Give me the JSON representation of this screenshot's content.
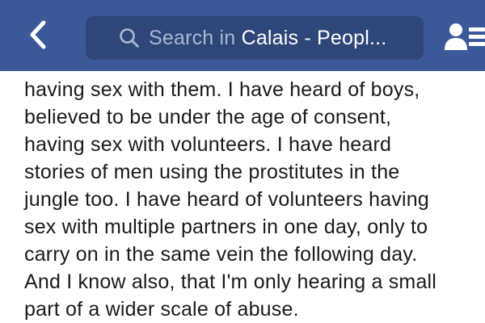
{
  "header": {
    "search": {
      "prefix": "Search in ",
      "group": "Calais - Peopl..."
    },
    "colors": {
      "bar": "#3b5998",
      "search_field": "#2f4679",
      "placeholder": "#a9b7d1"
    },
    "icons": {
      "back": "chevron-left-icon",
      "search": "magnifier-icon",
      "friends": "friend-requests-icon"
    }
  },
  "post": {
    "lines": [
      "having sex with them. I have heard of boys,",
      "believed to be under the age of consent,",
      "having sex with volunteers. I have heard",
      "stories of men using the prostitutes in the",
      "jungle too. I have heard of volunteers having",
      "sex with multiple partners in one day, only to",
      "carry on in the same vein the following day.",
      "And I know also, that I'm only hearing a small",
      "part of a wider scale of abuse."
    ]
  }
}
